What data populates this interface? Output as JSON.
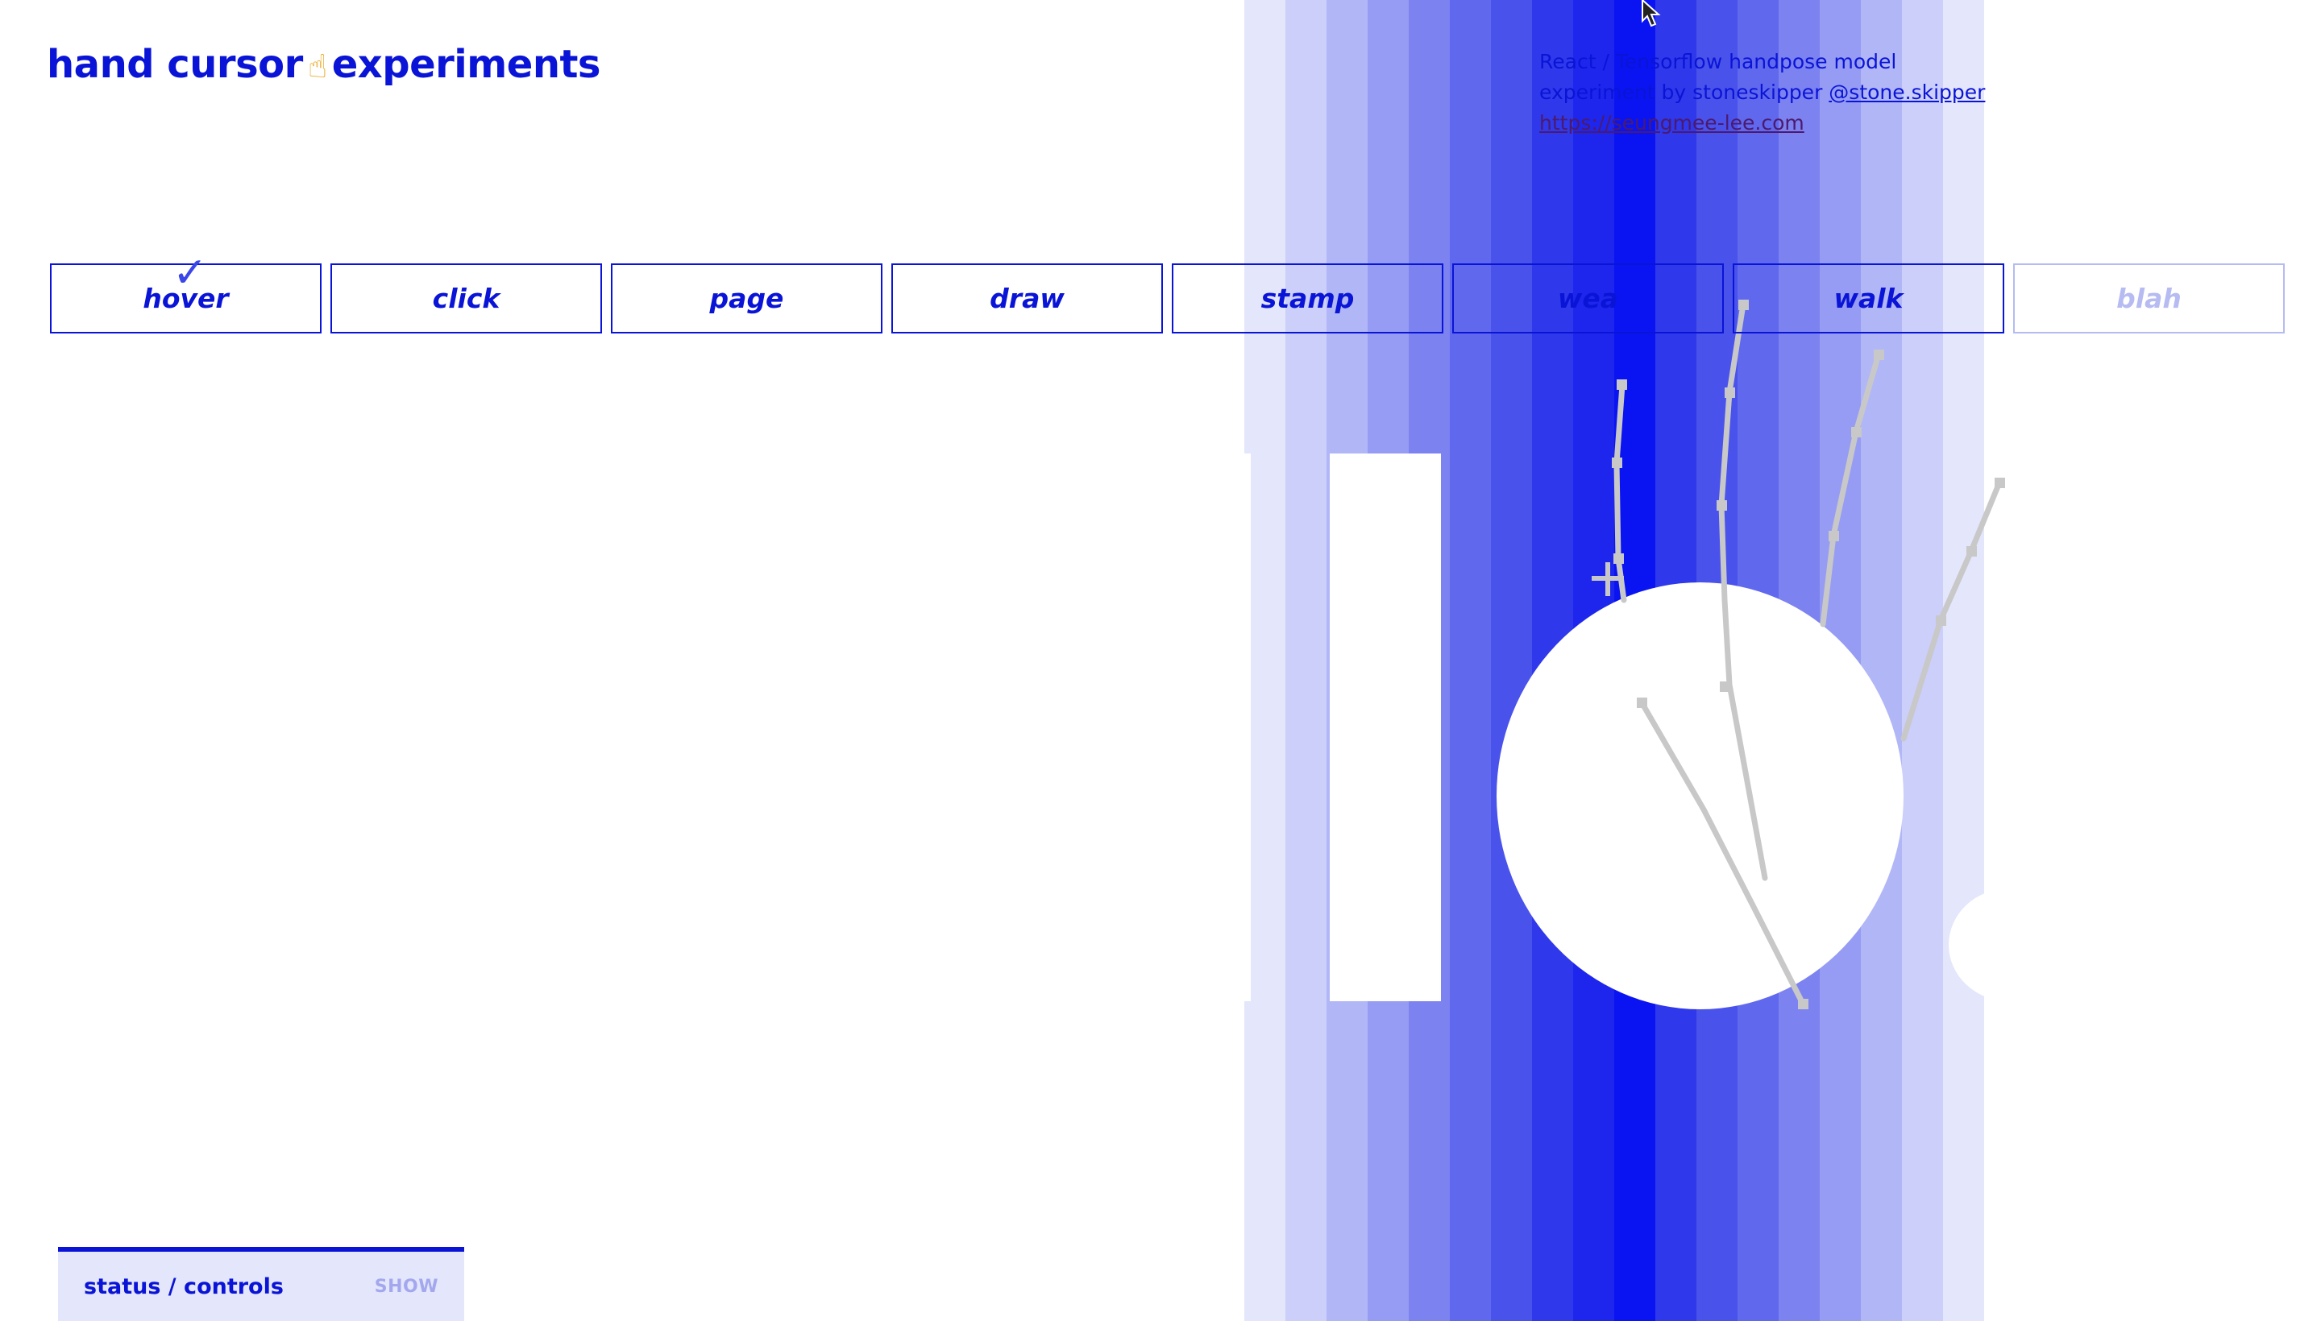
{
  "header": {
    "title_part1": "hand cursor",
    "title_emoji": "☝",
    "title_part2": "experiments"
  },
  "credits": {
    "line1": "React / Tensorflow handpose model",
    "line2_prefix": "experiment by stoneskipper ",
    "line2_handle": "@stone.skipper",
    "line3_url": "https://seungmee-lee.com"
  },
  "tabs": [
    {
      "label": "hover",
      "selected": true
    },
    {
      "label": "click"
    },
    {
      "label": "page"
    },
    {
      "label": "draw"
    },
    {
      "label": "stamp"
    },
    {
      "label": "wea"
    },
    {
      "label": "walk"
    },
    {
      "label": "blah",
      "disabled": true
    }
  ],
  "check_icon": "✓",
  "stage": {
    "stripe_colors": [
      "#e4e6fb",
      "#cbcffa",
      "#b1b6f7",
      "#969cf3",
      "#7c82f0",
      "#6068ee",
      "#4a52ec",
      "#2f38ea",
      "#1e26ee",
      "#0a14f2",
      "#2f38ea",
      "#4a52ec",
      "#6068ee",
      "#7c82f0",
      "#969cf3",
      "#b1b6f7",
      "#cbcffa",
      "#e4e6fb"
    ]
  },
  "status": {
    "label": "status / controls",
    "toggle": "SHOW"
  },
  "icons": {
    "mouse_cursor": "mouse-pointer-icon",
    "hand_skeleton": "hand-skeleton-icon",
    "crosshair": "crosshair-icon"
  },
  "colors": {
    "accent": "#0a14d6",
    "muted": "#b6bbf2",
    "panel_bg": "#e4e6fb"
  }
}
